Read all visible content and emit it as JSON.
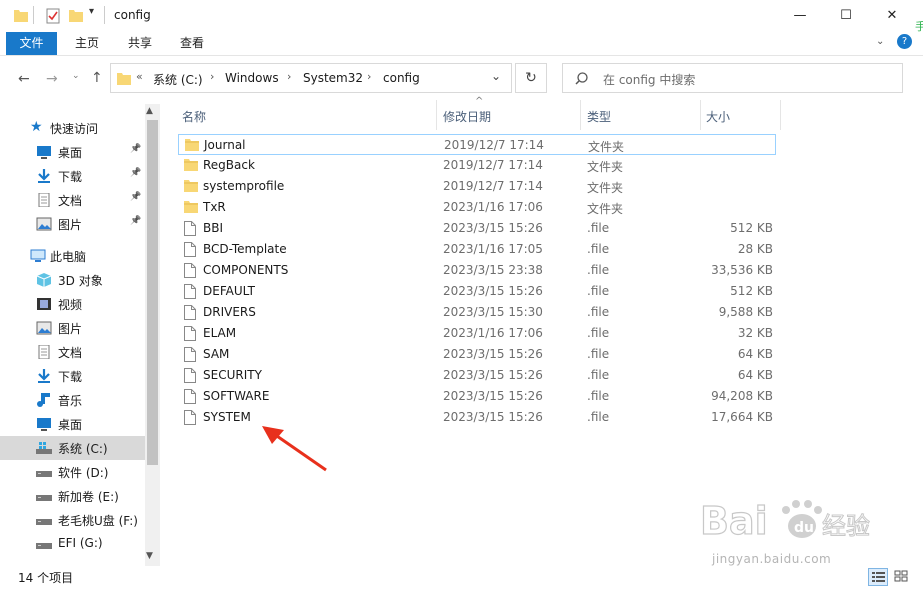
{
  "window": {
    "title": "config",
    "minimize": "—",
    "maximize": "☐",
    "close": "✕"
  },
  "ribbon": {
    "tabs": [
      "文件",
      "主页",
      "共享",
      "查看"
    ]
  },
  "address": {
    "prefix": "«",
    "segments": [
      "系统 (C:)",
      "Windows",
      "System32",
      "config"
    ],
    "search_placeholder": "在 config 中搜索"
  },
  "sidebar": {
    "quick_access": "快速访问",
    "quick_items": [
      {
        "label": "桌面",
        "icon": "desktop-icon"
      },
      {
        "label": "下载",
        "icon": "download-icon"
      },
      {
        "label": "文档",
        "icon": "document-icon"
      },
      {
        "label": "图片",
        "icon": "picture-icon"
      }
    ],
    "this_pc": "此电脑",
    "pc_items": [
      {
        "label": "3D 对象",
        "icon": "3d-objects-icon"
      },
      {
        "label": "视频",
        "icon": "video-icon"
      },
      {
        "label": "图片",
        "icon": "picture-icon"
      },
      {
        "label": "文档",
        "icon": "document-icon"
      },
      {
        "label": "下载",
        "icon": "download-icon"
      },
      {
        "label": "音乐",
        "icon": "music-icon"
      },
      {
        "label": "桌面",
        "icon": "desktop-icon"
      },
      {
        "label": "系统 (C:)",
        "icon": "system-drive-icon"
      },
      {
        "label": "软件 (D:)",
        "icon": "drive-icon"
      },
      {
        "label": "新加卷 (E:)",
        "icon": "drive-icon"
      },
      {
        "label": "老毛桃U盘 (F:)",
        "icon": "drive-icon"
      },
      {
        "label": "EFI (G:)",
        "icon": "drive-icon"
      }
    ]
  },
  "columns": {
    "name": "名称",
    "date": "修改日期",
    "type": "类型",
    "size": "大小"
  },
  "files": [
    {
      "name": "Journal",
      "date": "2019/12/7 17:14",
      "type": "文件夹",
      "size": "",
      "kind": "folder"
    },
    {
      "name": "RegBack",
      "date": "2019/12/7 17:14",
      "type": "文件夹",
      "size": "",
      "kind": "folder"
    },
    {
      "name": "systemprofile",
      "date": "2019/12/7 17:14",
      "type": "文件夹",
      "size": "",
      "kind": "folder"
    },
    {
      "name": "TxR",
      "date": "2023/1/16 17:06",
      "type": "文件夹",
      "size": "",
      "kind": "folder"
    },
    {
      "name": "BBI",
      "date": "2023/3/15 15:26",
      "type": ".file",
      "size": "512 KB",
      "kind": "file"
    },
    {
      "name": "BCD-Template",
      "date": "2023/1/16 17:05",
      "type": ".file",
      "size": "28 KB",
      "kind": "file"
    },
    {
      "name": "COMPONENTS",
      "date": "2023/3/15 23:38",
      "type": ".file",
      "size": "33,536 KB",
      "kind": "file"
    },
    {
      "name": "DEFAULT",
      "date": "2023/3/15 15:26",
      "type": ".file",
      "size": "512 KB",
      "kind": "file"
    },
    {
      "name": "DRIVERS",
      "date": "2023/3/15 15:30",
      "type": ".file",
      "size": "9,588 KB",
      "kind": "file"
    },
    {
      "name": "ELAM",
      "date": "2023/1/16 17:06",
      "type": ".file",
      "size": "32 KB",
      "kind": "file"
    },
    {
      "name": "SAM",
      "date": "2023/3/15 15:26",
      "type": ".file",
      "size": "64 KB",
      "kind": "file"
    },
    {
      "name": "SECURITY",
      "date": "2023/3/15 15:26",
      "type": ".file",
      "size": "64 KB",
      "kind": "file"
    },
    {
      "name": "SOFTWARE",
      "date": "2023/3/15 15:26",
      "type": ".file",
      "size": "94,208 KB",
      "kind": "file"
    },
    {
      "name": "SYSTEM",
      "date": "2023/3/15 15:26",
      "type": ".file",
      "size": "17,664 KB",
      "kind": "file"
    }
  ],
  "status": {
    "item_count": "14 个项目"
  },
  "watermark": {
    "logo_text": "Baidu经验",
    "url": "jingyan.baidu.com"
  },
  "colors": {
    "accent": "#1979ca",
    "folder": "#f8d775",
    "annotation_arrow": "#e8301c"
  }
}
